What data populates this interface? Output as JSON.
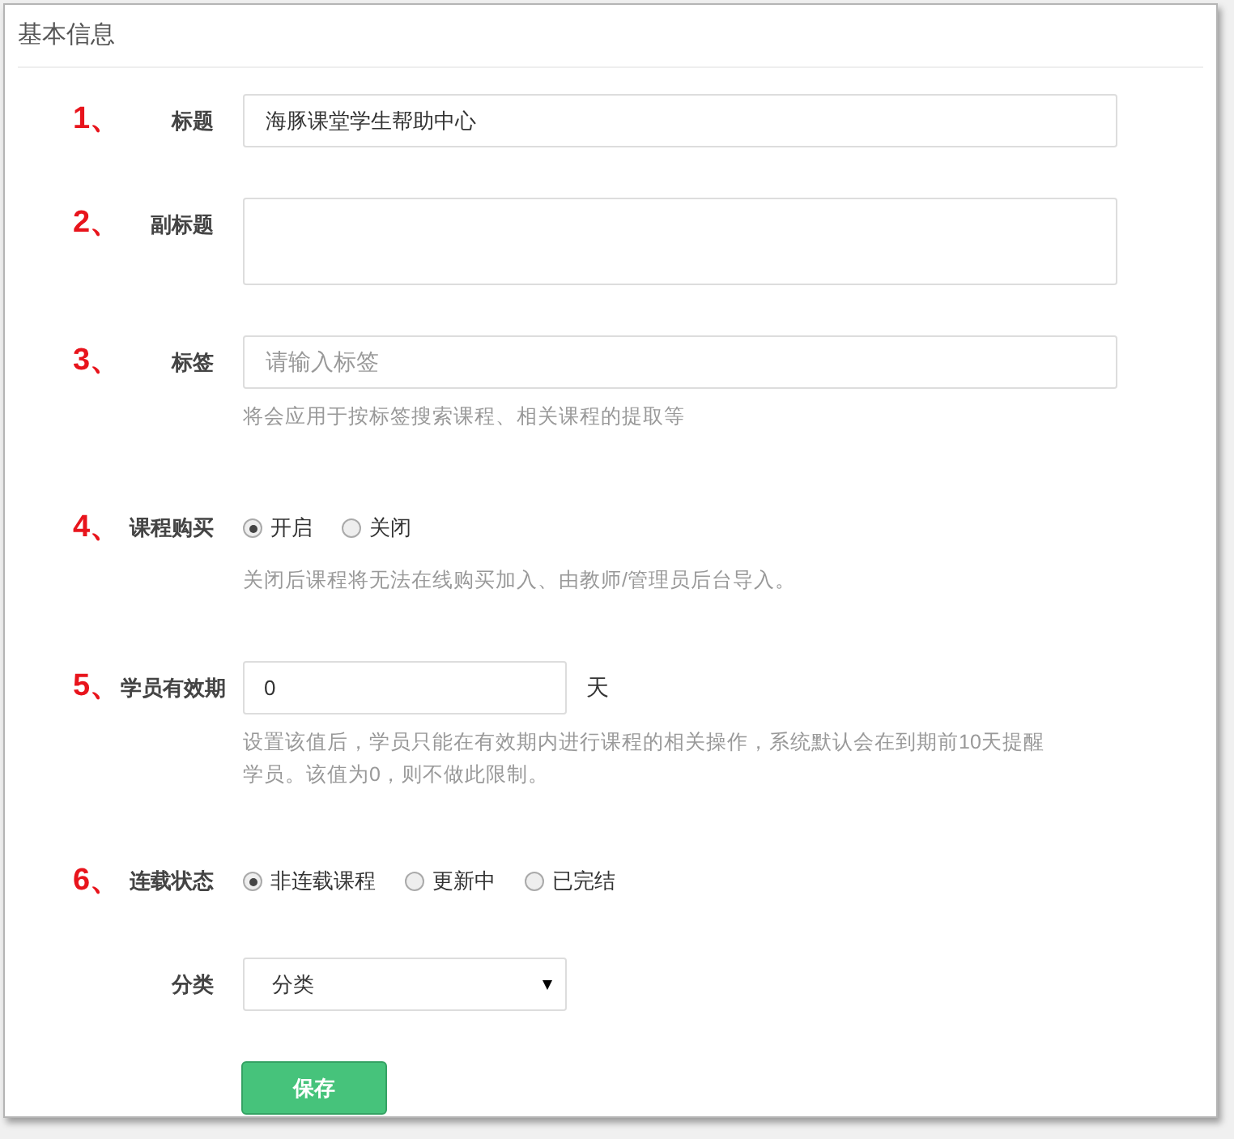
{
  "panel": {
    "title": "基本信息"
  },
  "fields": [
    {
      "kind": "text",
      "marker": "1、",
      "label": "标题",
      "value": "海豚课堂学生帮助中心"
    },
    {
      "kind": "textarea",
      "marker": "2、",
      "label": "副标题"
    },
    {
      "kind": "text",
      "marker": "3、",
      "label": "标签",
      "placeholder": "请输入标签",
      "help": [
        "将会应用于按标签搜索课程、相关课程的提取等"
      ]
    },
    {
      "kind": "radio",
      "marker": "4、",
      "label": "课程购买",
      "options": [
        {
          "label": "开启",
          "selected": true
        },
        {
          "label": "关闭",
          "selected": false
        }
      ],
      "help": [
        "关闭后课程将无法在线购买加入、由教师/管理员后台导入。"
      ]
    },
    {
      "kind": "number",
      "marker": "5、",
      "label": "学员有效期",
      "value": "0",
      "unit": "天",
      "help": [
        "设置该值后，学员只能在有效期内进行课程的相关操作，系统默认会在到期前10天提醒",
        "学员。该值为0，则不做此限制。"
      ]
    },
    {
      "kind": "radio",
      "marker": "6、",
      "label": "连载状态",
      "options": [
        {
          "label": "非连载课程",
          "selected": true
        },
        {
          "label": "更新中",
          "selected": false
        },
        {
          "label": "已完结",
          "selected": false
        }
      ]
    },
    {
      "kind": "select",
      "label": "分类",
      "value": "分类"
    }
  ],
  "save_button": "保存"
}
